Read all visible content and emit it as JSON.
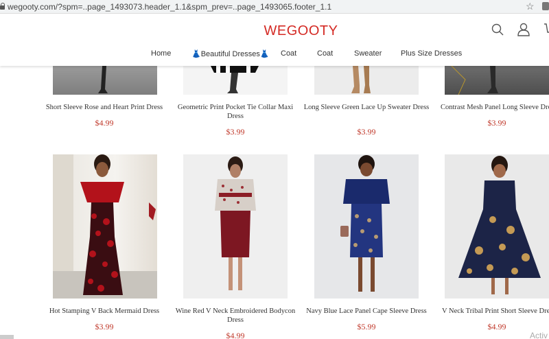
{
  "browser": {
    "url": "wegooty.com/?spm=..page_1493073.header_1.1&spm_prev=..page_1493065.footer_1.1"
  },
  "header": {
    "logo": "WEGOOTY"
  },
  "nav": [
    {
      "label": "Home"
    },
    {
      "label": "👗Beautiful Dresses👗"
    },
    {
      "label": "Coat"
    },
    {
      "label": "Coat"
    },
    {
      "label": "Sweater"
    },
    {
      "label": "Plus Size Dresses"
    }
  ],
  "products_top": [
    {
      "name": "Short Sleeve Rose and Heart Print Dress",
      "price": "$4.99"
    },
    {
      "name": "Geometric Print Pocket Tie Collar Maxi Dress",
      "price": "$3.99"
    },
    {
      "name": "Long Sleeve Green Lace Up Sweater Dress",
      "price": "$3.99"
    },
    {
      "name": "Contrast Mesh Panel Long Sleeve Dress",
      "price": "$3.99"
    }
  ],
  "products_bottom": [
    {
      "name": "Hot Stamping V Back Mermaid Dress",
      "price": "$3.99"
    },
    {
      "name": "Wine Red V Neck Embroidered Bodycon Dress",
      "price": "$4.99"
    },
    {
      "name": "Navy Blue Lace Panel Cape Sleeve Dress",
      "price": "$5.99"
    },
    {
      "name": "V Neck Tribal Print Short Sleeve Dress",
      "price": "$4.99"
    }
  ],
  "os_watermark": "Activ",
  "colors": {
    "brand": "#d42a24",
    "price": "#c0392b"
  }
}
